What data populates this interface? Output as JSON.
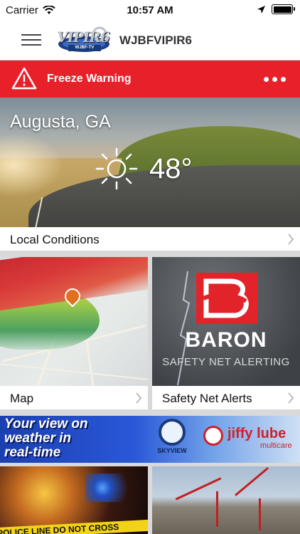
{
  "status_bar": {
    "carrier": "Carrier",
    "time": "10:57 AM"
  },
  "navbar": {
    "station_name": "WJBFVIPIR6",
    "logo_text": "VIPIR6",
    "logo_sub": "WJBF-TV"
  },
  "alert": {
    "text": "Freeze Warning"
  },
  "current": {
    "city": "Augusta, GA",
    "temperature": "48°",
    "condition_icon": "sun-icon"
  },
  "cards": {
    "local_conditions": "Local Conditions",
    "map": "Map",
    "safety_net": "Safety Net Alerts"
  },
  "baron": {
    "name": "BARON",
    "subtitle": "SAFETY NET ALERTING"
  },
  "ad_banner": {
    "line1": "Your view on",
    "line2": "weather in",
    "line3": "real-time",
    "skyview": "SKYVIEW",
    "jiffy": "jiffy lube",
    "jiffy_sub": "multicare"
  },
  "bottom_tile": {
    "tape_text": "POLICE LINE DO NOT CROSS"
  },
  "colors": {
    "alert_red": "#e8202a",
    "baron_red": "#e2232a"
  }
}
